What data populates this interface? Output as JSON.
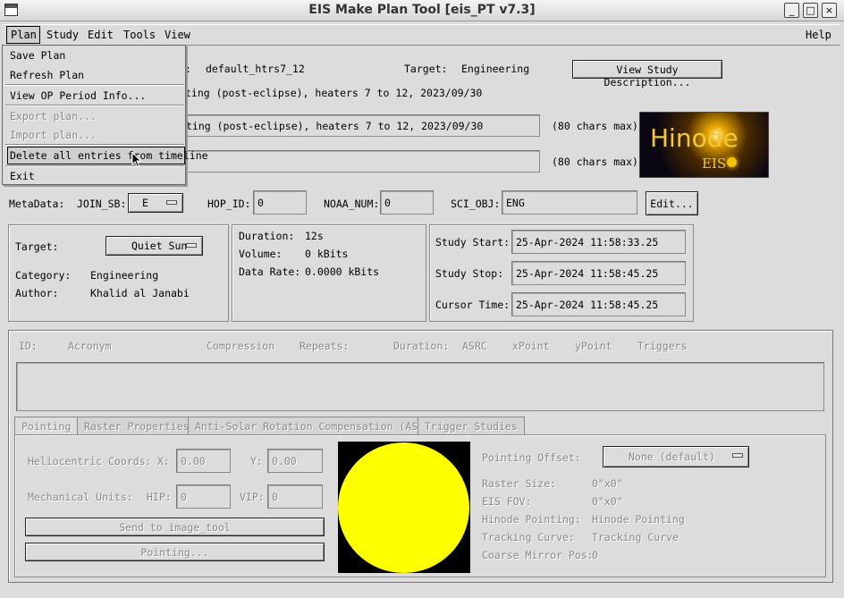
{
  "window": {
    "title": "EIS Make Plan Tool [eis_PT v7.3]",
    "minimize": "_",
    "maximize": "□",
    "close": "×"
  },
  "menubar": {
    "plan": "Plan",
    "study": "Study",
    "edit": "Edit",
    "tools": "Tools",
    "view": "View",
    "help": "Help"
  },
  "plan_menu": {
    "items": [
      "Save Plan",
      "Refresh Plan",
      "View OP Period Info...",
      "Export plan...",
      "Import plan...",
      "Delete all entries from timeline",
      "Exit"
    ],
    "disabled": [
      "Export plan...",
      "Import plan..."
    ]
  },
  "study": {
    "label_partial": ":",
    "name": "default_htrs7_12",
    "target_label": "Target:",
    "target_value": "Engineering",
    "view_desc_button": "View Study Description...",
    "description_line": "ting (post-eclipse), heaters 7 to 12, 2023/09/30",
    "title_field": "ting (post-eclipse), heaters 7 to 12, 2023/09/30",
    "title_hint": "(80 chars max)",
    "comment_field": "",
    "comment_hint": "(80 chars max)"
  },
  "logo": {
    "main": "Hinode",
    "sub": "EIS"
  },
  "metadata": {
    "label": "MetaData:",
    "join_sb_label": "JOIN_SB:",
    "join_sb_value": "E",
    "hop_id_label": "HOP_ID:",
    "hop_id_value": "0",
    "noaa_num_label": "NOAA_NUM:",
    "noaa_num_value": "0",
    "sci_obj_label": "SCI_OBJ:",
    "sci_obj_value": "ENG",
    "edit_button": "Edit..."
  },
  "info_left": {
    "target_label": "Target:",
    "target_value": "Quiet Sun",
    "category_label": "Category:",
    "category_value": "Engineering",
    "author_label": "Author:",
    "author_value": "Khalid al Janabi"
  },
  "info_mid": {
    "duration_label": "Duration:",
    "duration_value": "12s",
    "volume_label": "Volume:",
    "volume_value": "0 kBits",
    "rate_label": "Data Rate:",
    "rate_value": "0.0000 kBits"
  },
  "info_right": {
    "start_label": "Study Start:",
    "start_value": "25-Apr-2024 11:58:33.25",
    "stop_label": "Study Stop:",
    "stop_value": "25-Apr-2024 11:58:45.25",
    "cursor_label": "Cursor Time:",
    "cursor_value": "25-Apr-2024 11:58:45.25"
  },
  "table_headers": {
    "id": "ID:",
    "acronym": "Acronym",
    "compression": "Compression",
    "repeats": "Repeats:",
    "duration": "Duration:",
    "asrc": "ASRC",
    "xpoint": "xPoint",
    "ypoint": "yPoint",
    "triggers": "Triggers"
  },
  "tabs": [
    "Pointing",
    "Raster Properties",
    "Anti-Solar Rotation Compensation (ASRC)",
    "Trigger Studies"
  ],
  "pointing": {
    "helio_label": "Heliocentric Coords:",
    "x_label": "X:",
    "x_value": "0.00",
    "y_label": "Y:",
    "y_value": "0.00",
    "mech_label": "Mechanical Units:",
    "hip_label": "HIP:",
    "hip_value": "0",
    "vip_label": "VIP:",
    "vip_value": "0",
    "send_button": "Send to image_tool",
    "pointing_button": "Pointing...",
    "offset_label": "Pointing Offset:",
    "offset_value": "None (default)",
    "raster_size_label": "Raster Size:",
    "raster_size_value": "0\"x0\"",
    "eis_fov_label": "EIS FOV:",
    "eis_fov_value": "0\"x0\"",
    "hinode_pointing_label": "Hinode Pointing:",
    "hinode_pointing_value": "Hinode Pointing",
    "tracking_label": "Tracking Curve:",
    "tracking_value": "Tracking Curve",
    "coarse_label": "Coarse Mirror Pos:",
    "coarse_value": "0"
  },
  "colors": {
    "sun": "#ffff00",
    "sun_bg": "#000000",
    "window_bg": "#dcdcdc"
  }
}
